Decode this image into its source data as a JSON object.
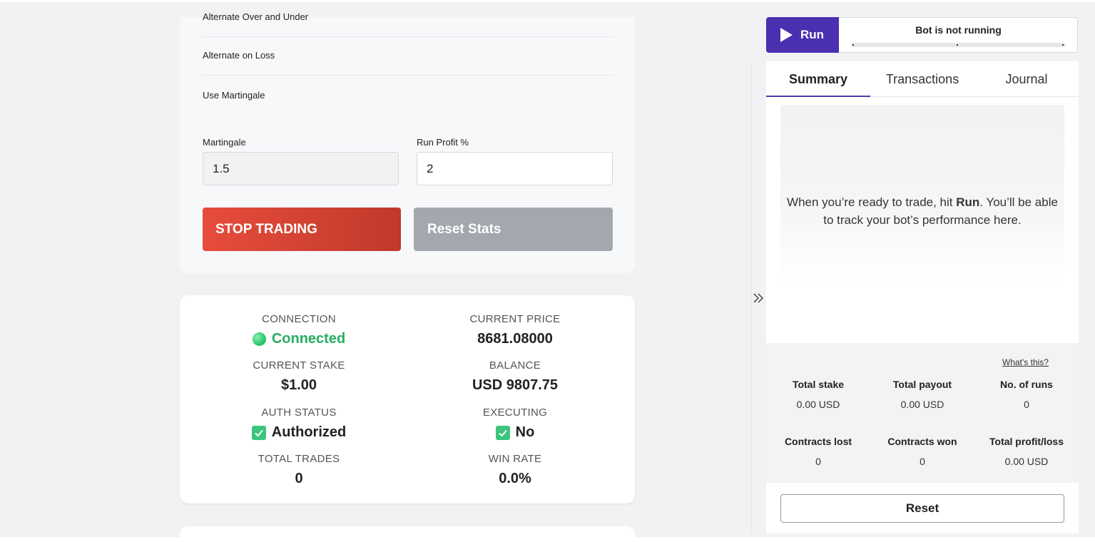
{
  "settings": {
    "options": [
      {
        "label": "Alternate Over and Under"
      },
      {
        "label": "Alternate on Loss"
      },
      {
        "label": "Use Martingale"
      }
    ],
    "martingale": {
      "label": "Martingale",
      "value": "1.5"
    },
    "run_profit": {
      "label": "Run Profit %",
      "value": "2"
    },
    "stop_button": "STOP TRADING",
    "reset_stats_button": "Reset Stats"
  },
  "status": {
    "connection": {
      "label": "CONNECTION",
      "value": "Connected"
    },
    "current_price": {
      "label": "CURRENT PRICE",
      "value": "8681.08000"
    },
    "current_stake": {
      "label": "CURRENT STAKE",
      "value": "$1.00"
    },
    "balance": {
      "label": "BALANCE",
      "value": "USD 9807.75"
    },
    "auth_status": {
      "label": "AUTH STATUS",
      "value": "Authorized"
    },
    "executing": {
      "label": "EXECUTING",
      "value": "No"
    },
    "total_trades": {
      "label": "TOTAL TRADES",
      "value": "0"
    },
    "win_rate": {
      "label": "WIN RATE",
      "value": "0.0%"
    }
  },
  "run_panel": {
    "run_label": "Run",
    "bot_status": "Bot is not running",
    "tabs": [
      {
        "label": "Summary"
      },
      {
        "label": "Transactions"
      },
      {
        "label": "Journal"
      }
    ],
    "empty_message": {
      "pre": "When you’re ready to trade, hit ",
      "bold": "Run",
      "post": ". You’ll be able to track your bot’s performance here."
    },
    "whats_this": "What's this?",
    "summary": {
      "total_stake": {
        "label": "Total stake",
        "value": "0.00 USD"
      },
      "total_payout": {
        "label": "Total payout",
        "value": "0.00 USD"
      },
      "runs": {
        "label": "No. of runs",
        "value": "0"
      },
      "contracts_lost": {
        "label": "Contracts lost",
        "value": "0"
      },
      "contracts_won": {
        "label": "Contracts won",
        "value": "0"
      },
      "total_profit": {
        "label": "Total profit/loss",
        "value": "0.00 USD"
      }
    },
    "reset_button": "Reset"
  },
  "colors": {
    "accent": "#4a2fb0",
    "stop": "#e74c3c",
    "connected": "#27ae60",
    "check": "#3cc47c"
  }
}
